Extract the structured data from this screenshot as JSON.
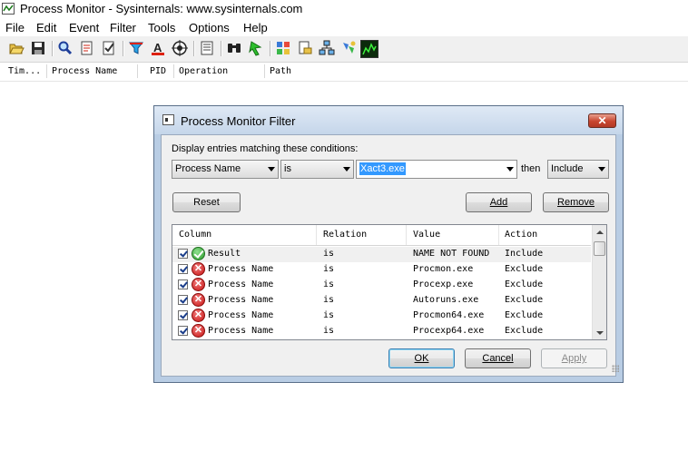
{
  "window": {
    "title": "Process Monitor - Sysinternals: www.sysinternals.com"
  },
  "menu": [
    "File",
    "Edit",
    "Event",
    "Filter",
    "Tools",
    "Options",
    "Help"
  ],
  "toolbar_icons": [
    "open-icon",
    "save-icon",
    "magnify-icon",
    "capture-icon",
    "autoscroll-icon",
    "clear-icon",
    "filter-icon",
    "highlight-icon",
    "target-icon",
    "properties-icon",
    "find-icon",
    "jump-icon",
    "registry-icon",
    "filesystem-icon",
    "network-icon",
    "profiling-icon"
  ],
  "columns": [
    "Tim...",
    "Process Name",
    "PID",
    "Operation",
    "Path"
  ],
  "dialog": {
    "title": "Process Monitor Filter",
    "close": "✕",
    "prompt": "Display entries matching these conditions:",
    "field": "Process Name",
    "relation": "is",
    "value": "Xact3.exe",
    "then_label": "then",
    "action": "Include",
    "reset_label": "Reset",
    "add_label": "Add",
    "remove_label": "Remove",
    "list_headers": [
      "Column",
      "Relation",
      "Value",
      "Action"
    ],
    "rows": [
      {
        "status": "include",
        "column": "Result",
        "relation": "is",
        "value": "NAME NOT FOUND",
        "action": "Include"
      },
      {
        "status": "exclude",
        "column": "Process Name",
        "relation": "is",
        "value": "Procmon.exe",
        "action": "Exclude"
      },
      {
        "status": "exclude",
        "column": "Process Name",
        "relation": "is",
        "value": "Procexp.exe",
        "action": "Exclude"
      },
      {
        "status": "exclude",
        "column": "Process Name",
        "relation": "is",
        "value": "Autoruns.exe",
        "action": "Exclude"
      },
      {
        "status": "exclude",
        "column": "Process Name",
        "relation": "is",
        "value": "Procmon64.exe",
        "action": "Exclude"
      },
      {
        "status": "exclude",
        "column": "Process Name",
        "relation": "is",
        "value": "Procexp64.exe",
        "action": "Exclude"
      }
    ],
    "ok_label": "OK",
    "cancel_label": "Cancel",
    "apply_label": "Apply"
  }
}
